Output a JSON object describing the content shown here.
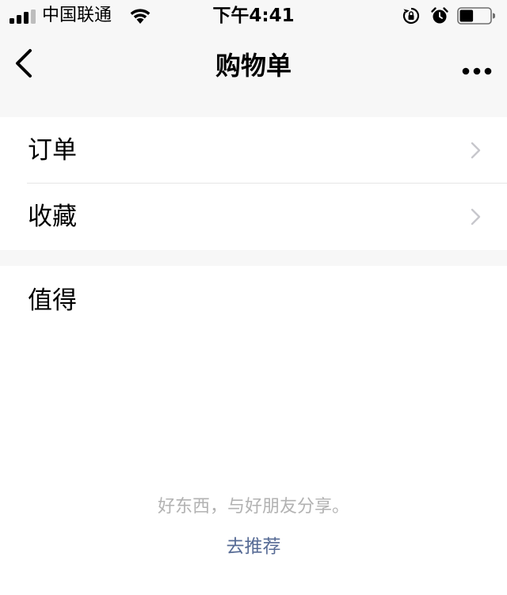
{
  "status_bar": {
    "carrier": "中国联通",
    "time": "下午4:41",
    "battery_level_percent": 45,
    "icons": [
      "signal-icon",
      "wifi-icon",
      "orientation-lock-icon",
      "alarm-icon",
      "battery-icon"
    ]
  },
  "nav": {
    "title": "购物单",
    "back_icon": "chevron-left-icon",
    "more_icon": "more-dots-icon"
  },
  "menu": {
    "items": [
      {
        "label": "订单",
        "icon": "chevron-right-icon"
      },
      {
        "label": "收藏",
        "icon": "chevron-right-icon"
      }
    ]
  },
  "worth": {
    "title": "值得",
    "empty_hint": "好东西，与好朋友分享。",
    "recommend_label": "去推荐"
  },
  "colors": {
    "background": "#f7f7f7",
    "card": "#ffffff",
    "link": "#576b95",
    "hint": "#b2b2b2",
    "chevron": "#c7c7cc"
  }
}
